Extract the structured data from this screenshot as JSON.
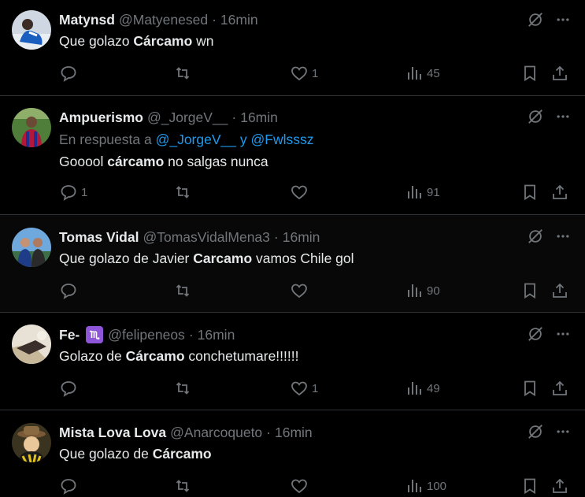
{
  "tweets": [
    {
      "name": "Matynsd",
      "handle": "@Matyenesed",
      "time": "16min",
      "text": [
        {
          "t": "Que golazo ",
          "b": false
        },
        {
          "t": "Cárcamo",
          "b": true
        },
        {
          "t": " wn",
          "b": false
        }
      ],
      "replies": "",
      "likes": "1",
      "views": "45"
    },
    {
      "name": "Ampuerismo",
      "handle": "@_JorgeV__",
      "time": "16min",
      "replying_prefix": "En respuesta a ",
      "replying_to_1": "@_JorgeV__",
      "replying_join": " y ",
      "replying_to_2": "@Fwlsssz",
      "text": [
        {
          "t": "Gooool ",
          "b": false
        },
        {
          "t": "cárcamo",
          "b": true
        },
        {
          "t": " no salgas nunca",
          "b": false
        }
      ],
      "replies": "1",
      "likes": "",
      "views": "91"
    },
    {
      "name": "Tomas Vidal",
      "handle": "@TomasVidalMena3",
      "time": "16min",
      "text": [
        {
          "t": "Que golazo de Javier ",
          "b": false
        },
        {
          "t": "Carcamo",
          "b": true
        },
        {
          "t": " vamos Chile gol",
          "b": false
        }
      ],
      "replies": "",
      "likes": "",
      "views": "90"
    },
    {
      "name": "Fe-",
      "badge_icon": "scorpio-icon",
      "handle": "@felipeneos",
      "time": "16min",
      "text": [
        {
          "t": "Golazo de ",
          "b": false
        },
        {
          "t": "Cárcamo",
          "b": true
        },
        {
          "t": " conchetumare!!!!!!",
          "b": false
        }
      ],
      "replies": "",
      "likes": "1",
      "views": "49"
    },
    {
      "name": "Mista Lova Lova",
      "handle": "@Anarcoqueto",
      "time": "16min",
      "text": [
        {
          "t": "Que golazo de ",
          "b": false
        },
        {
          "t": "Cárcamo",
          "b": true
        }
      ],
      "replies": "",
      "likes": "",
      "views": "100"
    }
  ],
  "dot": "·",
  "colors": {
    "background": "#000000",
    "text": "#e7e9ea",
    "muted": "#71767b",
    "link": "#1d9bf0",
    "divider": "#2f3336",
    "badge": "#8e55d9"
  }
}
